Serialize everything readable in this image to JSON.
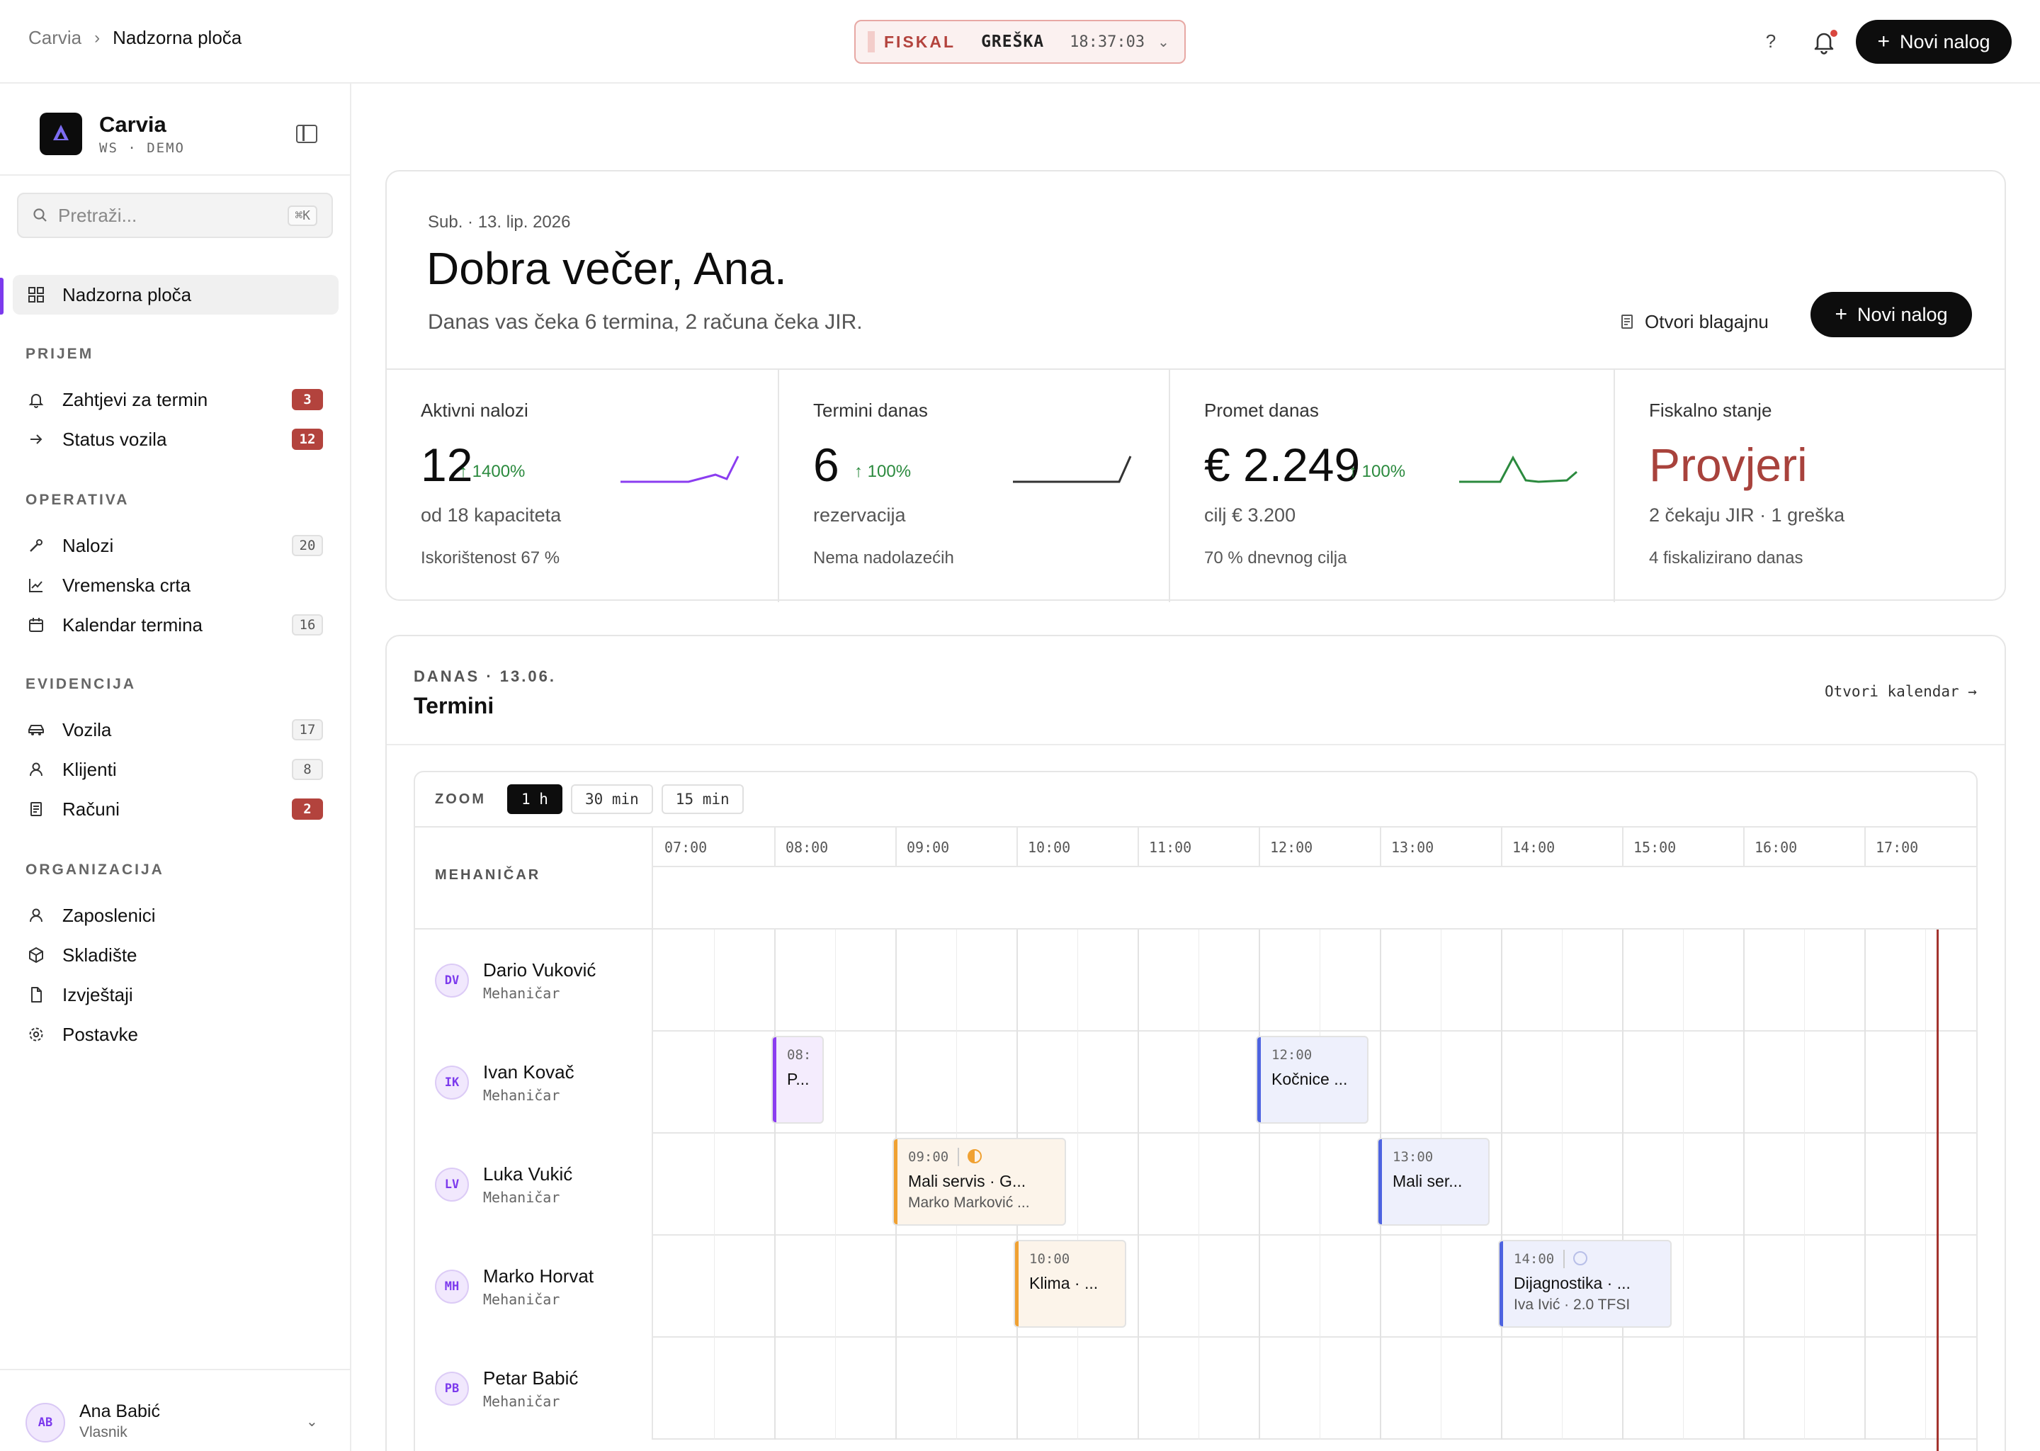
{
  "breadcrumb": {
    "root": "Carvia",
    "current": "Nadzorna ploča"
  },
  "fiscal_pill": {
    "label": "FISKAL",
    "status": "GREŠKA",
    "time": "18:37:03"
  },
  "topbar": {
    "help": "?",
    "new_order": "Novi nalog"
  },
  "brand": {
    "name": "Carvia",
    "workspace": "WS · DEMO"
  },
  "search": {
    "placeholder": "Pretraži...",
    "shortcut": "⌘K"
  },
  "nav": {
    "dashboard": "Nadzorna ploča",
    "sections": {
      "prijem": "PRIJEM",
      "operativa": "OPERATIVA",
      "evidencija": "EVIDENCIJA",
      "organizacija": "ORGANIZACIJA"
    },
    "items": {
      "zahtjevi": {
        "label": "Zahtjevi za termin",
        "badge": "3"
      },
      "status_vozila": {
        "label": "Status vozila",
        "badge": "12"
      },
      "nalozi": {
        "label": "Nalozi",
        "badge": "20"
      },
      "vremenska_crta": {
        "label": "Vremenska crta"
      },
      "kalendar": {
        "label": "Kalendar termina",
        "badge": "16"
      },
      "vozila": {
        "label": "Vozila",
        "badge": "17"
      },
      "klijenti": {
        "label": "Klijenti",
        "badge": "8"
      },
      "racuni": {
        "label": "Računi",
        "badge": "2"
      },
      "zaposlenici": {
        "label": "Zaposlenici"
      },
      "skladiste": {
        "label": "Skladište"
      },
      "izvjestaji": {
        "label": "Izvještaji"
      },
      "postavke": {
        "label": "Postavke"
      }
    }
  },
  "user": {
    "initials": "AB",
    "name": "Ana Babić",
    "role": "Vlasnik"
  },
  "hero": {
    "date": "Sub. · 13. lip. 2026",
    "greeting": "Dobra večer, Ana.",
    "summary": "Danas vas čeka 6 termina, 2 računa čeka JIR.",
    "open_cash": "Otvori blagajnu",
    "new_order": "Novi nalog"
  },
  "kpis": {
    "active_orders": {
      "title": "Aktivni nalozi",
      "value": "12",
      "delta": "↑ 1400%",
      "sub": "od 18 kapaciteta",
      "foot": "Iskorištenost 67 %",
      "color": "#8b3df0"
    },
    "appointments": {
      "title": "Termini danas",
      "value": "6",
      "delta": "↑ 100%",
      "sub": "rezervacija",
      "foot": "Nema nadolazećih",
      "color": "#333333"
    },
    "revenue": {
      "title": "Promet danas",
      "value": "€ 2.249",
      "delta": "↑ 100%",
      "sub": "cilj € 3.200",
      "foot": "70 % dnevnog cilja",
      "color": "#2b8a3e"
    },
    "fiscal": {
      "title": "Fiskalno stanje",
      "value": "Provjeri",
      "sub": "2 čekaju JIR · 1 greška",
      "foot": "4 fiskalizirano danas",
      "color": "#a8423c"
    }
  },
  "schedule": {
    "eyebrow": "DANAS · 13.06.",
    "title": "Termini",
    "open_calendar": "Otvori kalendar →",
    "zoom_label": "ZOOM",
    "zoom_options": [
      "1 h",
      "30 min",
      "15 min"
    ],
    "zoom_selected": "1 h",
    "mechanic_header": "MEHANIČAR",
    "hours": [
      "07:00",
      "08:00",
      "09:00",
      "10:00",
      "11:00",
      "12:00",
      "13:00",
      "14:00",
      "15:00",
      "16:00",
      "17:00"
    ],
    "mechanics": [
      {
        "initials": "DV",
        "name": "Dario Vuković",
        "role": "Mehaničar"
      },
      {
        "initials": "IK",
        "name": "Ivan Kovač",
        "role": "Mehaničar"
      },
      {
        "initials": "LV",
        "name": "Luka Vukić",
        "role": "Mehaničar"
      },
      {
        "initials": "MH",
        "name": "Marko Horvat",
        "role": "Mehaničar"
      },
      {
        "initials": "PB",
        "name": "Petar Babić",
        "role": "Mehaničar"
      }
    ],
    "appointments": [
      {
        "mechanic": 1,
        "start": "08:00",
        "end": "08:30",
        "time": "08:",
        "title": "P...",
        "sub": "",
        "color": "#8b3df0",
        "bg": "#f4ecfd"
      },
      {
        "mechanic": 1,
        "start": "12:00",
        "end": "13:00",
        "time": "12:00",
        "title": "Kočnice ...",
        "sub": "",
        "color": "#4d63e0",
        "bg": "#eef0fc"
      },
      {
        "mechanic": 2,
        "start": "09:00",
        "end": "10:30",
        "time": "09:00",
        "title": "Mali servis · G...",
        "sub": "Marko Marković ...",
        "color": "#f0a132",
        "bg": "#fcf4ea",
        "icon": "half-circle-icon"
      },
      {
        "mechanic": 2,
        "start": "13:00",
        "end": "14:00",
        "time": "13:00",
        "title": "Mali ser...",
        "sub": "",
        "color": "#4d63e0",
        "bg": "#eef0fc"
      },
      {
        "mechanic": 3,
        "start": "10:00",
        "end": "11:00",
        "time": "10:00",
        "title": "Klima · ...",
        "sub": "",
        "color": "#f0a132",
        "bg": "#fcf4ea"
      },
      {
        "mechanic": 3,
        "start": "14:00",
        "end": "15:30",
        "time": "14:00",
        "title": "Dijagnostika · ...",
        "sub": "Iva Ivić · 2.0 TFSI",
        "color": "#4d63e0",
        "bg": "#eef0fc",
        "icon": "empty-circle-icon"
      }
    ]
  }
}
